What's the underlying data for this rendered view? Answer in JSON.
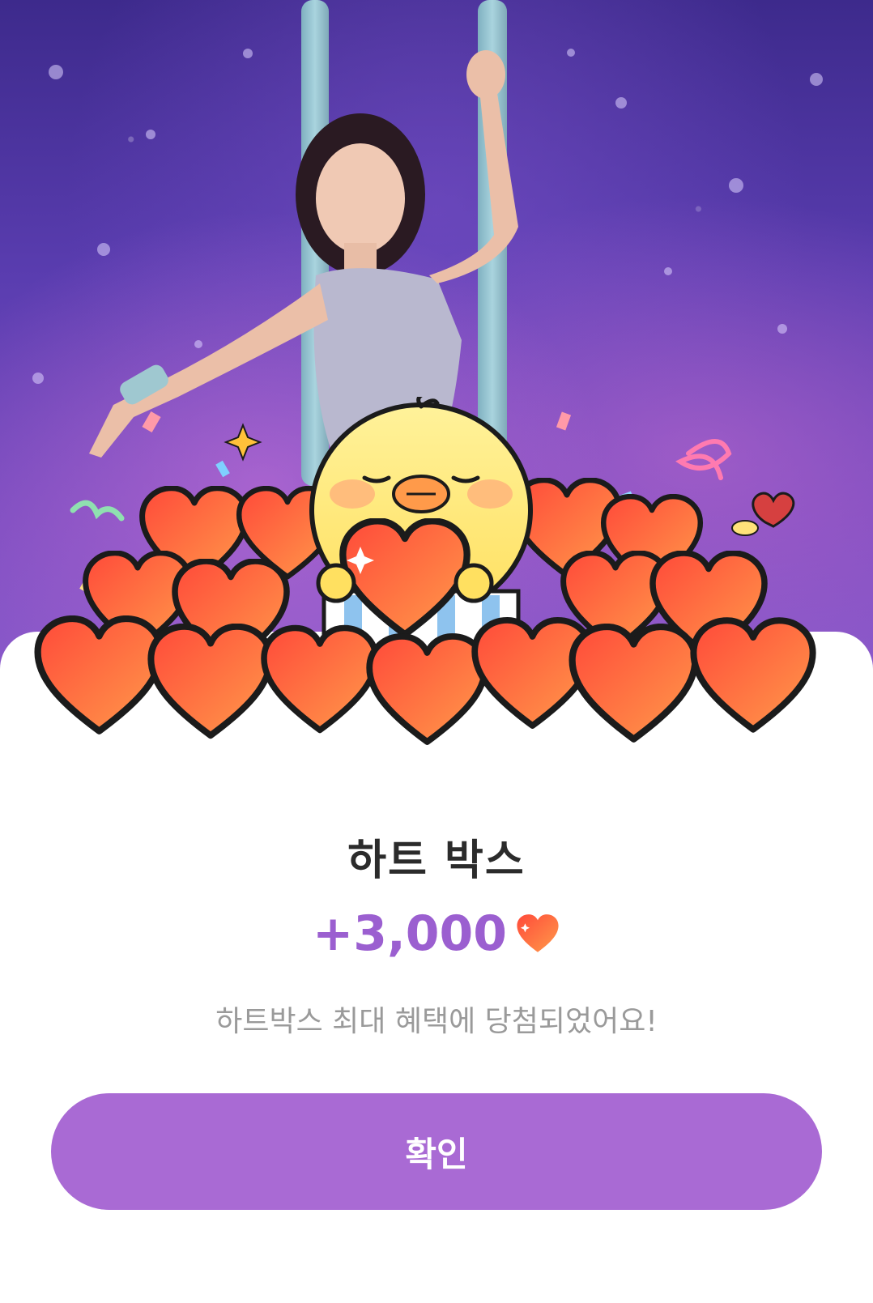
{
  "popup": {
    "title": "하트 박스",
    "reward_amount": "+3,000",
    "reward_icon": "heart-icon",
    "message": "하트박스 최대 혜택에 당첨되었어요!",
    "confirm_label": "확인"
  },
  "colors": {
    "accent": "#a96ad4",
    "reward_text": "#9b5fd0",
    "heart": "#ff5a3c",
    "title_text": "#2b2b2b",
    "message_text": "#9a9a9a"
  }
}
